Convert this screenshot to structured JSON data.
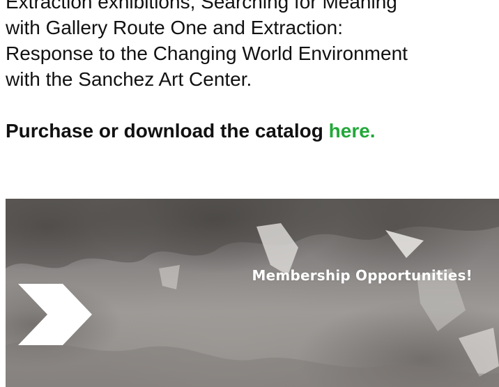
{
  "article": {
    "paragraph_lines": [
      "Extraction exhibitions, Searching for Meaning",
      "with Gallery Route One and Extraction:",
      "Response to the Changing World Environment",
      "with the Sanchez Art Center."
    ],
    "catalog_text": "Purchase or download the catalog ",
    "catalog_link": "here."
  },
  "banner": {
    "title": "Membership Opportunities!",
    "arrow_icon": "chevron-right-icon"
  },
  "colors": {
    "link": "#23a839",
    "text": "#111111",
    "banner_text": "#ffffff"
  }
}
